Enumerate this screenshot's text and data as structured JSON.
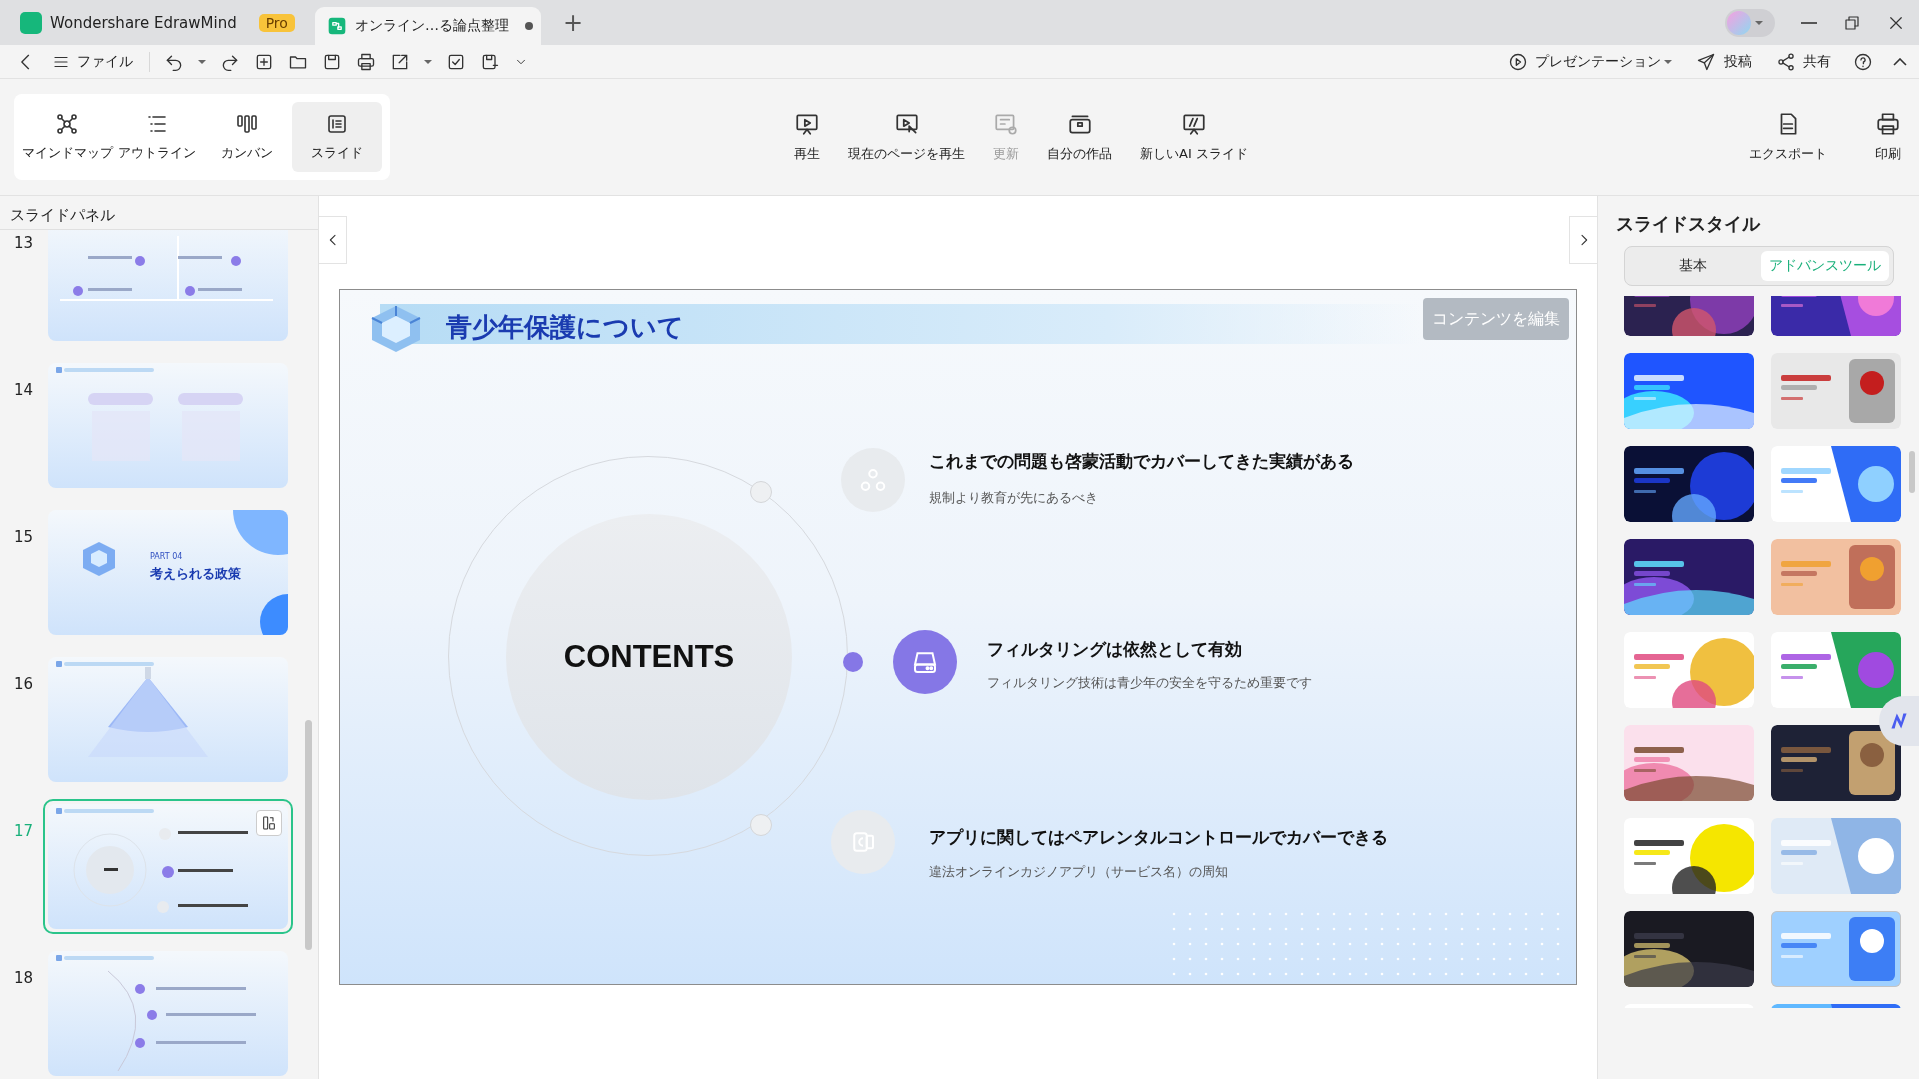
{
  "app_tab": {
    "title": "Wondershare EdrawMind",
    "badge": "Pro"
  },
  "doc_tab": {
    "title": "オンライン…る論点整理",
    "unsaved": true,
    "selected": true
  },
  "new_tab": "+",
  "menu": {
    "label": "ファイル"
  },
  "right_actions": [
    {
      "kind": "present",
      "label": "プレゼンテーション"
    },
    {
      "kind": "post",
      "label": "投稿"
    },
    {
      "kind": "share",
      "label": "共有"
    }
  ],
  "view_modes": [
    {
      "kind": "mindmap",
      "label": "マインドマップ",
      "selected": false
    },
    {
      "kind": "outline",
      "label": "アウトライン",
      "selected": false
    },
    {
      "kind": "kanban",
      "label": "カンバン",
      "selected": false
    },
    {
      "kind": "slide",
      "label": "スライド",
      "selected": true
    }
  ],
  "ribbon": [
    {
      "kind": "play",
      "label": "再生",
      "disabled": false
    },
    {
      "kind": "play-current",
      "label": "現在のページを再生",
      "disabled": false
    },
    {
      "kind": "update",
      "label": "更新",
      "disabled": true
    },
    {
      "kind": "works",
      "label": "自分の作品",
      "disabled": false
    },
    {
      "kind": "ai",
      "label": "新しいAI スライド",
      "disabled": false
    }
  ],
  "ribbon_right": [
    {
      "kind": "export",
      "label": "エクスポート"
    },
    {
      "kind": "print",
      "label": "印刷"
    }
  ],
  "slide_panel": {
    "title": "スライドパネル",
    "slides": [
      {
        "number": "13",
        "kind": "timeline",
        "selected": false
      },
      {
        "number": "14",
        "kind": "cards",
        "selected": false
      },
      {
        "number": "15",
        "kind": "section",
        "part": "PART 04",
        "title": "考えられる政策",
        "selected": false
      },
      {
        "number": "16",
        "kind": "funnel",
        "selected": false
      },
      {
        "number": "17",
        "kind": "contents",
        "selected": true
      },
      {
        "number": "18",
        "kind": "list",
        "selected": false
      }
    ]
  },
  "slide": {
    "title": "青少年保護について",
    "edit_button": "コンテンツを編集",
    "center": "CONTENTS",
    "items": [
      {
        "kind": "nodes",
        "heading": "これまでの問題も啓蒙活動でカバーしてきた実績がある",
        "sub": "規制より教育が先にあるべき",
        "selected": false
      },
      {
        "kind": "drive",
        "heading": "フィルタリングは依然として有効",
        "sub": "フィルタリング技術は青少年の安全を守るため重要です",
        "selected": true
      },
      {
        "kind": "app",
        "heading": "アプリに関してはペアレンタルコントロールでカバーできる",
        "sub": "違法オンラインカジノアプリ（サービス名）の周知",
        "selected": false
      }
    ]
  },
  "style_panel": {
    "title": "スライドスタイル",
    "tabs": [
      {
        "label": "基本",
        "selected": false
      },
      {
        "label": "アドバンスツール",
        "selected": true
      }
    ],
    "templates": [
      {
        "kind": "picture",
        "selected": false
      },
      {
        "kind": "picture",
        "selected": false
      },
      {
        "kind": "picture",
        "selected": false
      },
      {
        "kind": "picture",
        "selected": false
      },
      {
        "kind": "picture",
        "selected": false
      },
      {
        "kind": "picture",
        "selected": false
      },
      {
        "kind": "picture",
        "selected": false
      },
      {
        "kind": "picture",
        "selected": false
      },
      {
        "kind": "picture",
        "selected": false
      },
      {
        "kind": "picture",
        "selected": false
      },
      {
        "kind": "picture",
        "selected": false
      },
      {
        "kind": "picture",
        "selected": false
      },
      {
        "kind": "picture",
        "selected": false
      },
      {
        "kind": "picture",
        "selected": false
      },
      {
        "kind": "picture",
        "selected": false
      },
      {
        "kind": "picture",
        "selected": true
      },
      {
        "kind": "picture",
        "selected": false
      },
      {
        "kind": "picture",
        "selected": false
      }
    ]
  }
}
